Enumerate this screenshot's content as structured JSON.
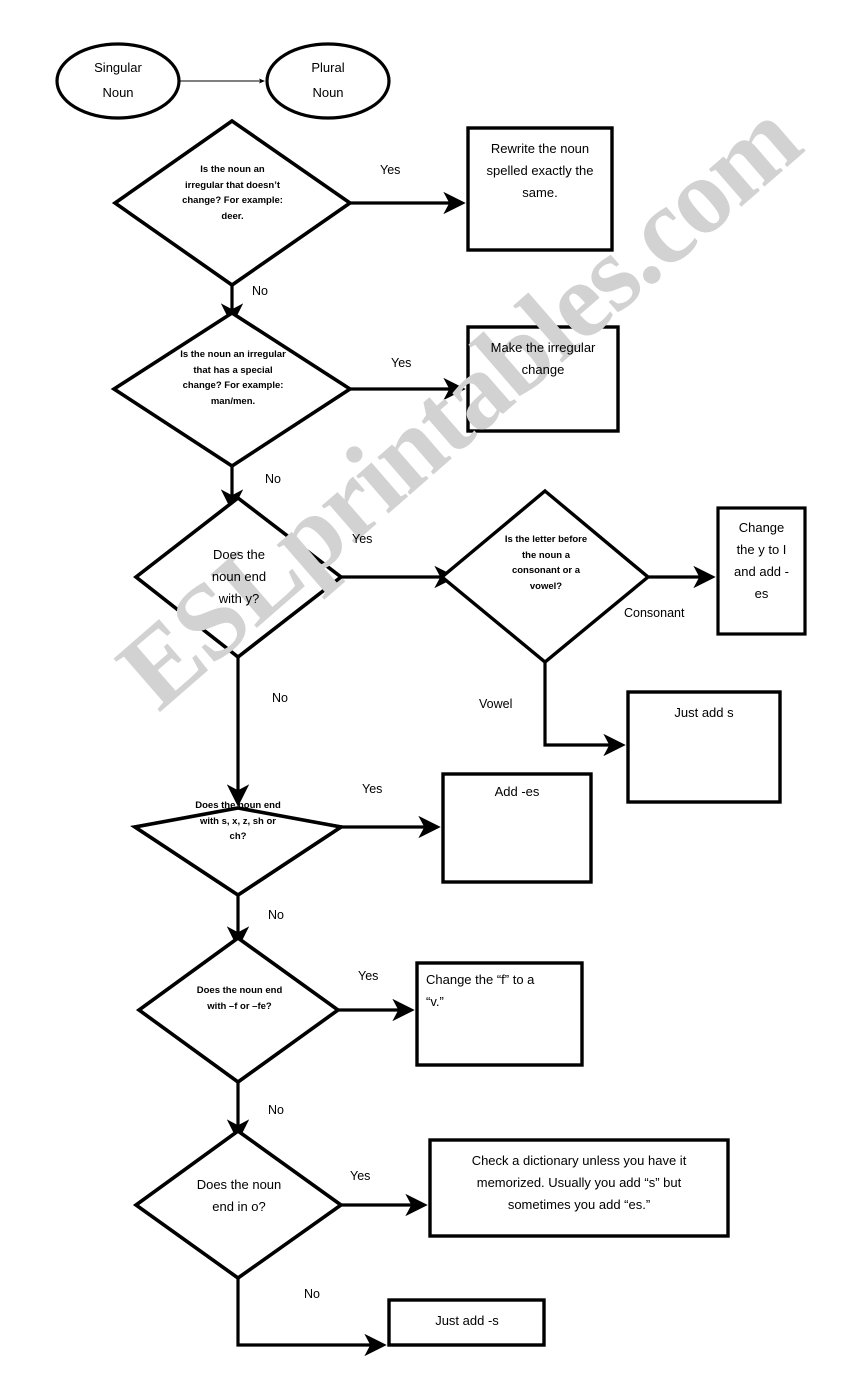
{
  "watermark": {
    "text": "ESLprintables.com",
    "color": "#d2d2d2"
  },
  "diagram": {
    "title_nodes": {
      "singular": "Singular\nNoun",
      "singular_line1": "Singular",
      "singular_line2": "Noun",
      "plural_line1": "Plural",
      "plural_line2": "Noun"
    },
    "nodes": [
      {
        "id": "start-singular",
        "shape": "ellipse",
        "text": "Singular Noun"
      },
      {
        "id": "start-plural",
        "shape": "ellipse",
        "text": "Plural Noun"
      },
      {
        "id": "q-irregular-nochange",
        "shape": "diamond",
        "text": "Is the noun an irregular that doesn’t change? For example: deer."
      },
      {
        "id": "a-rewrite-same",
        "shape": "box",
        "text": "Rewrite the noun spelled exactly the same."
      },
      {
        "id": "q-irregular-special",
        "shape": "diamond",
        "text": "Is the noun an irregular that has a special change? For example: man/men."
      },
      {
        "id": "a-make-irregular",
        "shape": "box",
        "text": "Make the irregular change"
      },
      {
        "id": "q-end-y",
        "shape": "diamond",
        "text": "Does the noun end with y?"
      },
      {
        "id": "q-consonant-vowel",
        "shape": "diamond",
        "text": "Is the letter before the noun a consonant or a vowel?"
      },
      {
        "id": "a-y-to-i",
        "shape": "box",
        "text": "Change the y to I and add -es"
      },
      {
        "id": "a-just-add-s",
        "shape": "box",
        "text": "Just add s"
      },
      {
        "id": "q-end-sxzshch",
        "shape": "diamond",
        "text": "Does the noun end with s, x, z, sh or ch?"
      },
      {
        "id": "a-add-es",
        "shape": "box",
        "text": "Add -es"
      },
      {
        "id": "q-end-f-fe",
        "shape": "diamond",
        "text": "Does the noun end with –f or –fe?"
      },
      {
        "id": "a-f-to-v",
        "shape": "box",
        "text": "Change the “f” to a “v.”"
      },
      {
        "id": "q-end-o",
        "shape": "diamond",
        "text": "Does the noun end in o?"
      },
      {
        "id": "a-check-dictionary",
        "shape": "box",
        "text": "Check a dictionary unless you have it memorized.  Usually you add “s” but sometimes you add “es.”"
      },
      {
        "id": "a-just-add-dash-s",
        "shape": "box",
        "text": "Just add -s"
      }
    ],
    "node_text": {
      "q1_l1": "Is the noun an",
      "q1_l2": "irregular that doesn’t",
      "q1_l3": "change? For example:",
      "q1_l4": "deer.",
      "b1_l1": "Rewrite the noun",
      "b1_l2": "spelled exactly the",
      "b1_l3": "same.",
      "q2_l1": "Is the noun an irregular",
      "q2_l2": "that has a special",
      "q2_l3": "change?  For example:",
      "q2_l4": "man/men.",
      "b2_l1": "Make the irregular",
      "b2_l2": "change",
      "q3_l1": "Does the",
      "q3_l2": "noun end",
      "q3_l3": "with y?",
      "q4_l1": "Is the letter before",
      "q4_l2": "the noun a",
      "q4_l3": "consonant or a",
      "q4_l4": "vowel?",
      "b3_l1": "Change",
      "b3_l2": "the y to I",
      "b3_l3": "and add -",
      "b3_l4": "es",
      "b4_l1": "Just add s",
      "q5_l1": "Does the noun end",
      "q5_l2": "with s, x, z, sh or",
      "q5_l3": "ch?",
      "b5_l1": "Add -es",
      "q6_l1": "Does the noun end",
      "q6_l2": "with –f or –fe?",
      "b6_l1": "Change the “f” to a",
      "b6_l2": "“v.”",
      "q7_l1": "Does the noun",
      "q7_l2": "end in o?",
      "b7_l1": "Check a dictionary unless you have it",
      "b7_l2": "memorized.  Usually you add “s” but",
      "b7_l3": "sometimes you add “es.”",
      "b8_l1": "Just add -s"
    },
    "edge_labels": {
      "yes1": "Yes",
      "no1": "No",
      "yes2": "Yes",
      "no2": "No",
      "yes3": "Yes",
      "no3": "No",
      "consonant": "Consonant",
      "vowel": "Vowel",
      "yes4": "Yes",
      "no4": "No",
      "yes5": "Yes",
      "no5": "No",
      "yes6": "Yes",
      "no6": "No"
    },
    "colors": {
      "stroke": "#000000",
      "fill": "#ffffff",
      "text": "#000000"
    }
  }
}
